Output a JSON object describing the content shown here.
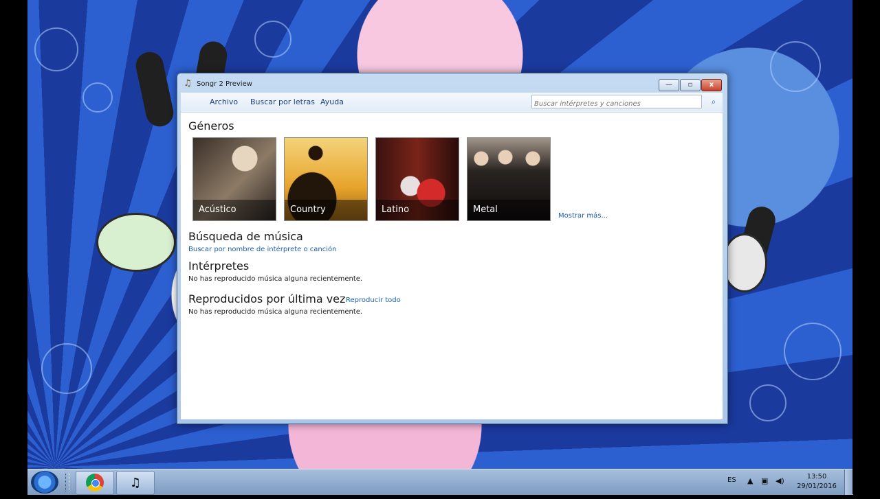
{
  "window": {
    "title": "Songr 2 Preview",
    "minimize": "—",
    "maximize": "▫",
    "close": "x"
  },
  "menu": {
    "items": [
      "Archivo",
      "Buscar por letras",
      "Ayuda"
    ],
    "search_placeholder": "Buscar intérpretes y canciones"
  },
  "content": {
    "genres_heading": "Géneros",
    "genres": [
      "Acústico",
      "Country",
      "Latino",
      "Metal"
    ],
    "show_more": "Mostrar más...",
    "music_search_heading": "Búsqueda de música",
    "music_search_link": "Buscar por nombre de intérprete o canción",
    "artists_heading": "Intérpretes",
    "artists_empty": "No has reproducido música alguna recientemente.",
    "recent_heading": "Reproducidos por última vez",
    "play_all": "Reproducir todo",
    "recent_empty": "No has reproducido música alguna recientemente."
  },
  "taskbar": {
    "language": "ES",
    "time": "13:50",
    "date": "29/01/2016"
  },
  "icons": {
    "app": "music-note-icon",
    "search": "search-icon",
    "start": "windows-start-icon",
    "chrome": "chrome-icon",
    "volume": "speaker-icon",
    "network": "network-icon",
    "tray_arrow": "tray-arrow-icon"
  }
}
